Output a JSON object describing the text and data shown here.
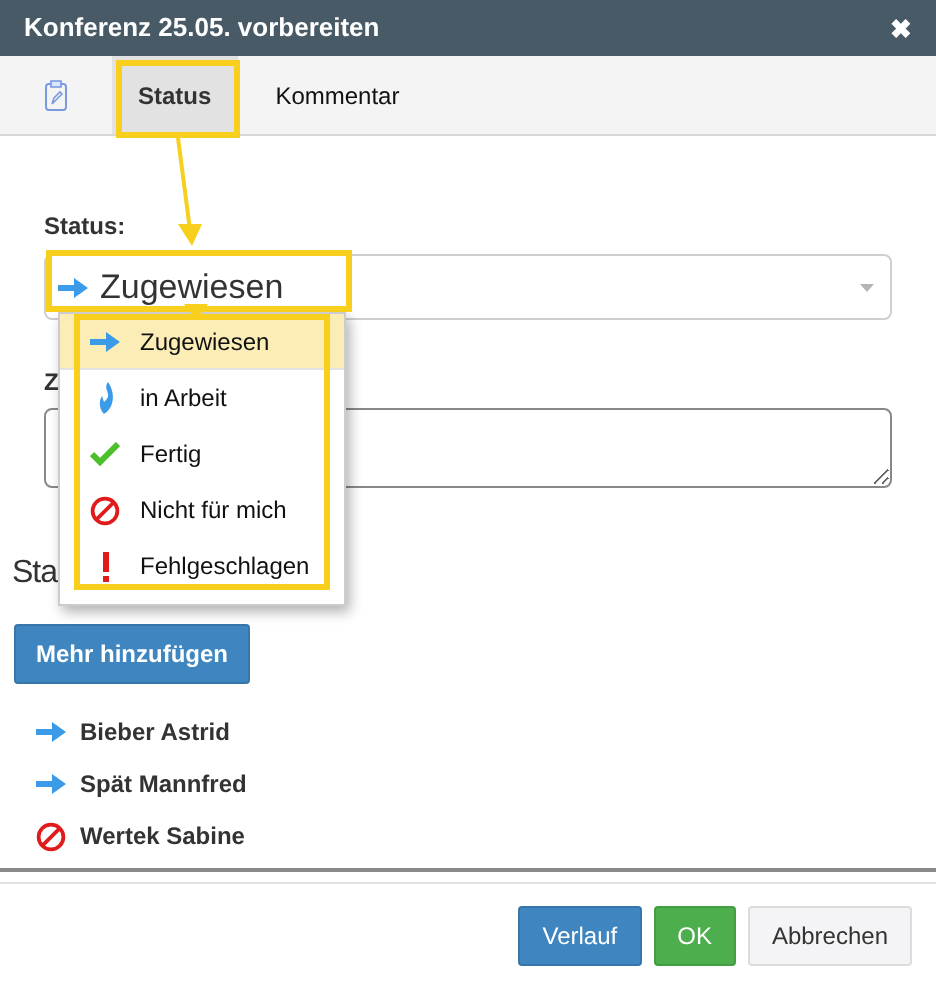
{
  "window": {
    "title": "Konferenz 25.05. vorbereiten",
    "close": "✖"
  },
  "tabs": [
    {
      "kind": "icon",
      "selected": false
    },
    {
      "kind": "text",
      "label": "Status",
      "selected": true
    },
    {
      "kind": "text",
      "label": "Kommentar",
      "selected": false
    }
  ],
  "status_field": {
    "label": "Status:",
    "value": "Zugewiesen",
    "kind": "assigned"
  },
  "status_options": [
    {
      "kind": "assigned",
      "label": "Zugewiesen",
      "selected": true
    },
    {
      "kind": "in_progress",
      "label": "in Arbeit",
      "selected": false
    },
    {
      "kind": "done",
      "label": "Fertig",
      "selected": false
    },
    {
      "kind": "declined",
      "label": "Nicht für mich",
      "selected": false
    },
    {
      "kind": "failed",
      "label": "Fehlgeschlagen",
      "selected": false
    }
  ],
  "comment_field": {
    "label": "Z"
  },
  "section_heading": "Sta",
  "add_button": "Mehr hinzufügen",
  "people": [
    {
      "kind": "assigned",
      "name": "Bieber Astrid"
    },
    {
      "kind": "assigned",
      "name": "Spät Mannfred"
    },
    {
      "kind": "declined",
      "name": "Wertek Sabine"
    }
  ],
  "buttons": [
    {
      "kind": "primary",
      "label": "Verlauf"
    },
    {
      "kind": "success",
      "label": "OK"
    },
    {
      "kind": "default",
      "label": "Abbrechen"
    }
  ]
}
